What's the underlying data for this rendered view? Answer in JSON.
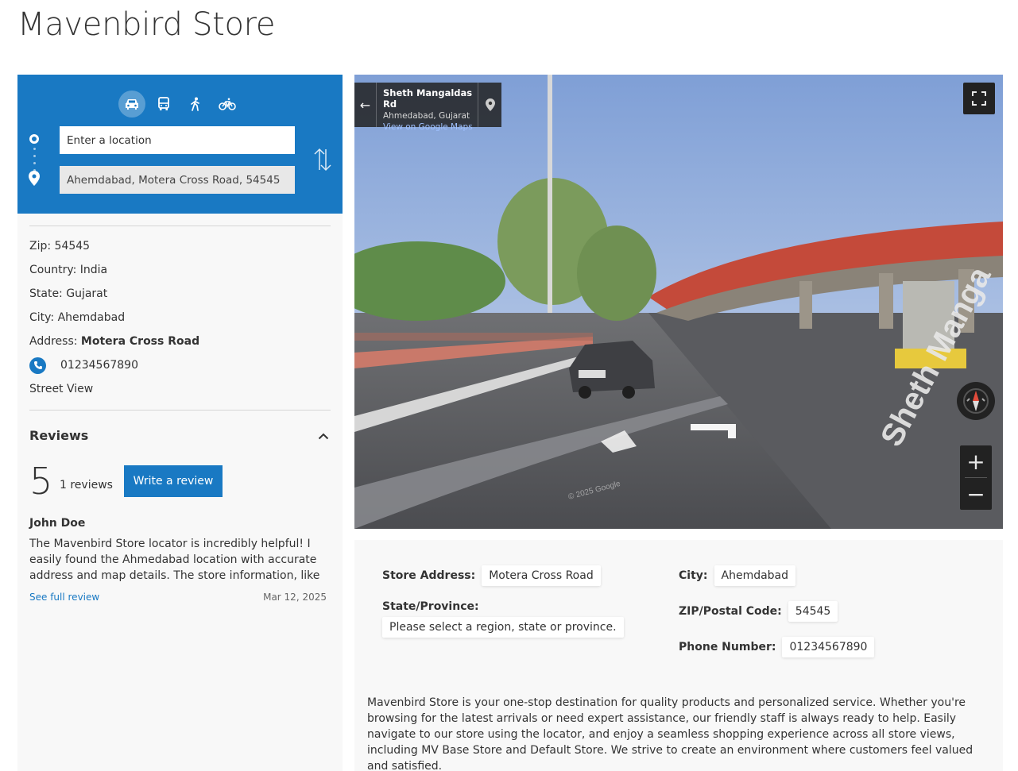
{
  "page": {
    "title": "Mavenbird Store"
  },
  "directions": {
    "modes": [
      "car-icon",
      "transit-icon",
      "walk-icon",
      "bicycle-icon"
    ],
    "active_mode": "car",
    "from_placeholder": "Enter a location",
    "to_value": "Ahemdabad, Motera Cross Road, 54545"
  },
  "store_info": {
    "zip": "Zip: 54545",
    "country": "Country: India",
    "state": "State: Gujarat",
    "city": "City: Ahemdabad",
    "address_label": "Address: ",
    "address_value": "Motera Cross Road",
    "phone": "01234567890",
    "street_view_link": "Street View"
  },
  "reviews": {
    "title": "Reviews",
    "score": "5",
    "count": "1 reviews",
    "write_button": "Write a review",
    "items": [
      {
        "author": "John Doe",
        "text": "The Mavenbird Store locator is incredibly helpful! I easily found the Ahmedabad location with accurate address and map details. The store information, like phone number",
        "link": "See full review",
        "date": "Mar 12, 2025"
      }
    ]
  },
  "street_view": {
    "street": "Sheth Mangaldas Rd",
    "area": "Ahmedabad, Gujarat",
    "map_link": "View on Google Maps",
    "road_label": "Sheth Manga",
    "watermark": "© 2025 Google",
    "zoom_in": "+",
    "zoom_out": "−"
  },
  "details": {
    "store_address_label": "Store Address:",
    "store_address_value": "Motera Cross Road",
    "city_label": "City:",
    "city_value": "Ahemdabad",
    "state_label": "State/Province:",
    "state_value": "Please select a region, state or province.",
    "zip_label": "ZIP/Postal Code:",
    "zip_value": "54545",
    "phone_label": "Phone Number:",
    "phone_value": "01234567890",
    "description": "Mavenbird Store is your one-stop destination for quality products and personalized service. Whether you're browsing for the latest arrivals or need expert assistance, our friendly staff is always ready to help. Easily navigate to our store using the locator, and enjoy a seamless shopping experience across all store views, including MV Base Store and Default Store. We strive to create an environment where customers feel valued and satisfied."
  },
  "colors": {
    "accent": "#1979c3",
    "panel_bg": "#f8f8f8",
    "text": "#333333"
  }
}
